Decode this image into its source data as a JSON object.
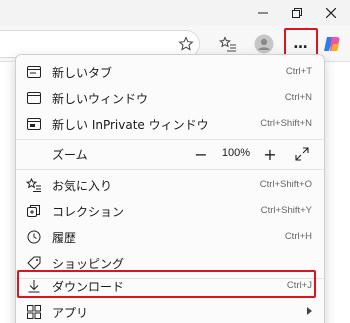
{
  "window_controls": {
    "minimize_icon": "minimize-icon",
    "restore_icon": "restore-icon",
    "close_icon": "close-icon"
  },
  "toolbar": {
    "favorite_icon": "star-icon",
    "favorites_icon": "favorites-list-icon",
    "profile_icon": "profile-icon",
    "more_label": "…",
    "copilot_icon": "copilot-icon"
  },
  "menu": {
    "new_tab": {
      "label": "新しいタブ",
      "shortcut": "Ctrl+T"
    },
    "new_window": {
      "label": "新しいウィンドウ",
      "shortcut": "Ctrl+N"
    },
    "new_inprivate": {
      "label": "新しい InPrivate ウィンドウ",
      "shortcut": "Ctrl+Shift+N"
    },
    "zoom": {
      "label": "ズーム",
      "minus": "−",
      "value": "100%",
      "plus": "+"
    },
    "favorites": {
      "label": "お気に入り",
      "shortcut": "Ctrl+Shift+O"
    },
    "collections": {
      "label": "コレクション",
      "shortcut": "Ctrl+Shift+Y"
    },
    "history": {
      "label": "履歴",
      "shortcut": "Ctrl+H"
    },
    "shopping": {
      "label": "ショッピング"
    },
    "downloads": {
      "label": "ダウンロード",
      "shortcut": "Ctrl+J"
    },
    "apps": {
      "label": "アプリ"
    }
  },
  "colors": {
    "highlight": "#d8161f"
  }
}
